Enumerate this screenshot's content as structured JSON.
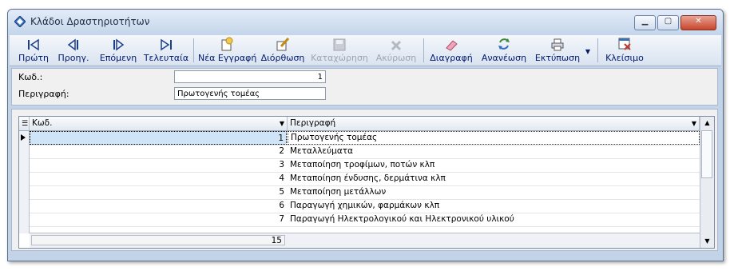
{
  "window": {
    "title": "Κλάδοι Δραστηριοτήτων"
  },
  "toolbar": [
    {
      "label": "Πρώτη",
      "icon": "first-record-icon",
      "enabled": true
    },
    {
      "label": "Προηγ.",
      "icon": "previous-record-icon",
      "enabled": true
    },
    {
      "label": "Επόμενη",
      "icon": "next-record-icon",
      "enabled": true
    },
    {
      "label": "Τελευταία",
      "icon": "last-record-icon",
      "enabled": true
    },
    {
      "label": "Νέα Εγγραφή",
      "icon": "new-record-icon",
      "enabled": true
    },
    {
      "label": "Διόρθωση",
      "icon": "edit-icon",
      "enabled": true
    },
    {
      "label": "Καταχώρηση",
      "icon": "save-icon",
      "enabled": false
    },
    {
      "label": "Ακύρωση",
      "icon": "cancel-icon",
      "enabled": false
    },
    {
      "label": "Διαγραφή",
      "icon": "delete-icon",
      "enabled": true
    },
    {
      "label": "Ανανέωση",
      "icon": "refresh-icon",
      "enabled": true
    },
    {
      "label": "Εκτύπωση",
      "icon": "print-icon",
      "enabled": true
    },
    {
      "label": "Κλείσιμο",
      "icon": "close-form-icon",
      "enabled": true
    }
  ],
  "form": {
    "code_label": "Κωδ.:",
    "code_value": "1",
    "desc_label": "Περιγραφή:",
    "desc_value": "Πρωτογενής τομέας"
  },
  "grid": {
    "columns": [
      "Κωδ.",
      "Περιγραφή"
    ],
    "rows": [
      {
        "code": "1",
        "desc": "Πρωτογενής τομέας"
      },
      {
        "code": "2",
        "desc": "Μεταλλεύματα"
      },
      {
        "code": "3",
        "desc": "Μεταποίηση τροφίμων, ποτών κλπ"
      },
      {
        "code": "4",
        "desc": "Μεταποίηση ένδυσης, δερμάτινα κλπ"
      },
      {
        "code": "5",
        "desc": "Μεταποίηση μετάλλων"
      },
      {
        "code": "6",
        "desc": "Παραγωγή χημικών, φαρμάκων κλπ"
      },
      {
        "code": "7",
        "desc": "Παραγωγή Ηλεκτρολογικού και Ηλεκτρονικού υλικού"
      }
    ],
    "selected_index": 0,
    "footer_count": "15"
  }
}
